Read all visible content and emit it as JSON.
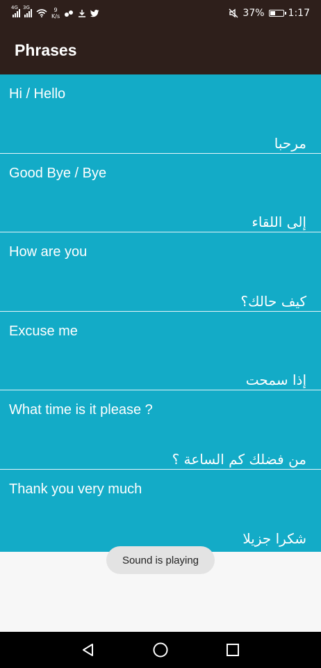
{
  "status_bar": {
    "signal1": "4G",
    "signal2": "3G",
    "net_speed_value": "9",
    "net_speed_unit": "K/s",
    "battery": "37%",
    "time": "1:17"
  },
  "app_bar": {
    "title": "Phrases"
  },
  "phrases": [
    {
      "english": "Hi / Hello",
      "arabic": "مرحبا"
    },
    {
      "english": "Good Bye / Bye",
      "arabic": "إلى اللقاء"
    },
    {
      "english": "How are you",
      "arabic": "كيف حالك؟"
    },
    {
      "english": "Excuse me",
      "arabic": "إذا سمحت"
    },
    {
      "english": "What time is it please ?",
      "arabic": "من فضلك كم الساعة ؟"
    },
    {
      "english": "Thank you very much",
      "arabic": "شكرا جزيلا"
    }
  ],
  "toast": {
    "message": "Sound is playing"
  },
  "colors": {
    "app_bar": "#2e1f1b",
    "list_background": "#13abc7",
    "divider": "#e8f6fa"
  },
  "battery_level": 0.37
}
